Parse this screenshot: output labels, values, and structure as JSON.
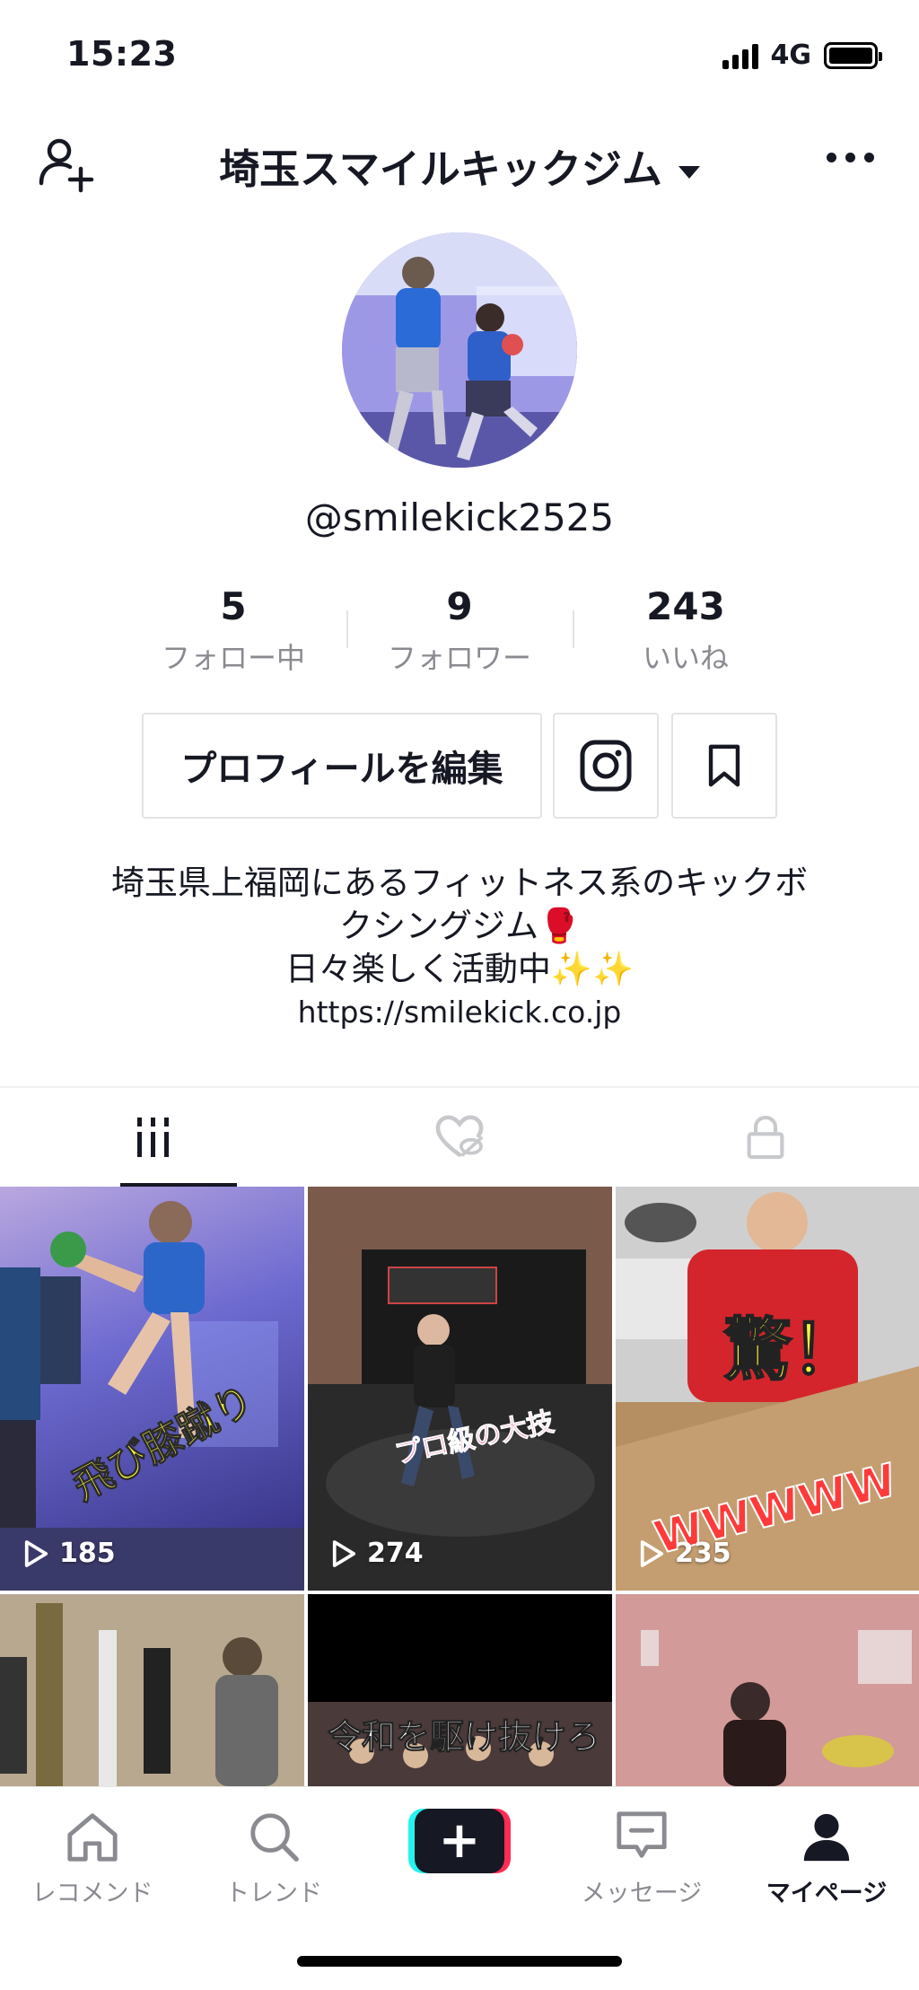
{
  "status_bar": {
    "time": "15:23",
    "network": "4G"
  },
  "header": {
    "account_name": "埼玉スマイルキックジム",
    "add_friend_icon": "add-user-icon",
    "more_icon": "more-dots-icon"
  },
  "profile": {
    "username": "@smilekick2525",
    "stats": [
      {
        "value": "5",
        "label": "フォロー中"
      },
      {
        "value": "9",
        "label": "フォロワー"
      },
      {
        "value": "243",
        "label": "いいね"
      }
    ],
    "edit_button": "プロフィールを編集",
    "bio_line1": "埼玉県上福岡にあるフィットネス系のキックボ",
    "bio_line2": "クシングジム🥊",
    "bio_line3": "日々楽しく活動中✨✨",
    "bio_link": "https://smilekick.co.jp"
  },
  "tabs": [
    {
      "icon": "grid-icon",
      "active": true
    },
    {
      "icon": "liked-heart-icon",
      "active": false
    },
    {
      "icon": "lock-icon",
      "active": false
    }
  ],
  "videos": [
    {
      "views": "185",
      "caption": "飛び膝蹴り"
    },
    {
      "views": "274",
      "caption": "プロ級の大技"
    },
    {
      "views": "235",
      "caption_top": "驚！",
      "caption_bottom": "WWWWW"
    },
    {
      "views": "",
      "caption": ""
    },
    {
      "views": "",
      "caption": "令和を駆け抜けろ"
    },
    {
      "views": "",
      "caption": ""
    }
  ],
  "bottom_nav": [
    {
      "label": "レコメンド",
      "icon": "home-icon"
    },
    {
      "label": "トレンド",
      "icon": "search-icon"
    },
    {
      "label": "",
      "icon": "plus-icon"
    },
    {
      "label": "メッセージ",
      "icon": "message-icon"
    },
    {
      "label": "マイページ",
      "icon": "profile-icon"
    }
  ],
  "colors": {
    "accent_cyan": "#25f4ee",
    "accent_red": "#fe2c55",
    "text": "#161823",
    "muted": "#8a8b91"
  }
}
